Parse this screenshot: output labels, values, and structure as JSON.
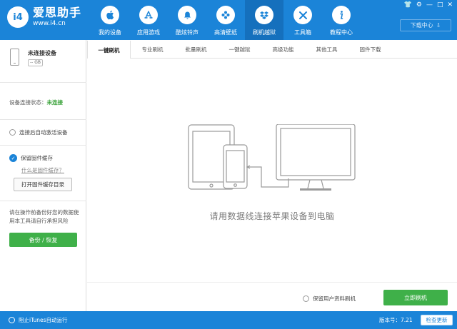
{
  "app": {
    "logo_mark": "i4",
    "name": "爱思助手",
    "url": "www.i4.cn"
  },
  "nav": [
    {
      "label": "我的设备",
      "icon": "apple-icon",
      "glyph": ""
    },
    {
      "label": "应用游戏",
      "icon": "app-store-icon",
      "glyph": "A"
    },
    {
      "label": "酷炫铃声",
      "icon": "bell-icon",
      "glyph": "🔔"
    },
    {
      "label": "高清壁纸",
      "icon": "flower-icon",
      "glyph": "✿"
    },
    {
      "label": "刷机越狱",
      "icon": "dropbox-icon",
      "glyph": "❖"
    },
    {
      "label": "工具箱",
      "icon": "tools-icon",
      "glyph": "✕"
    },
    {
      "label": "教程中心",
      "icon": "info-icon",
      "glyph": "i"
    }
  ],
  "window_controls": [
    "👕",
    "⚙",
    "—",
    "□",
    "✕"
  ],
  "download_center": {
    "label": "下载中心",
    "icon": "download-icon",
    "glyph": "⇩"
  },
  "device": {
    "name": "未连接设备",
    "capacity": "-- GB"
  },
  "connection": {
    "label": "设备连接状态：",
    "value": "未连接"
  },
  "options": {
    "auto_activate": "连接后自动激活设备",
    "keep_firmware": "保留固件缓存",
    "what_is_cache": "什么是固件缓存？",
    "open_cache_dir": "打开固件缓存目录"
  },
  "backup": {
    "warning": "请在操作前备份好您的数据使用本工具请自行承担风险",
    "button": "备份 / 恢复"
  },
  "tabs": [
    "一键刷机",
    "专业刷机",
    "批量刷机",
    "一键越狱",
    "高级功能",
    "其他工具",
    "固件下载"
  ],
  "main": {
    "hint": "请用数据线连接苹果设备到电脑",
    "keep_user_data": "保留用户资料刷机",
    "flash_now": "立即刷机"
  },
  "statusbar": {
    "block_itunes": "阻止iTunes自动运行",
    "version": "版本号：7.21",
    "check_update": "检查更新"
  },
  "colors": {
    "primary_blue": "#1b84d8",
    "active_nav_blue": "#1570bd",
    "green": "#3fb049",
    "status_green": "#3aa23a"
  }
}
